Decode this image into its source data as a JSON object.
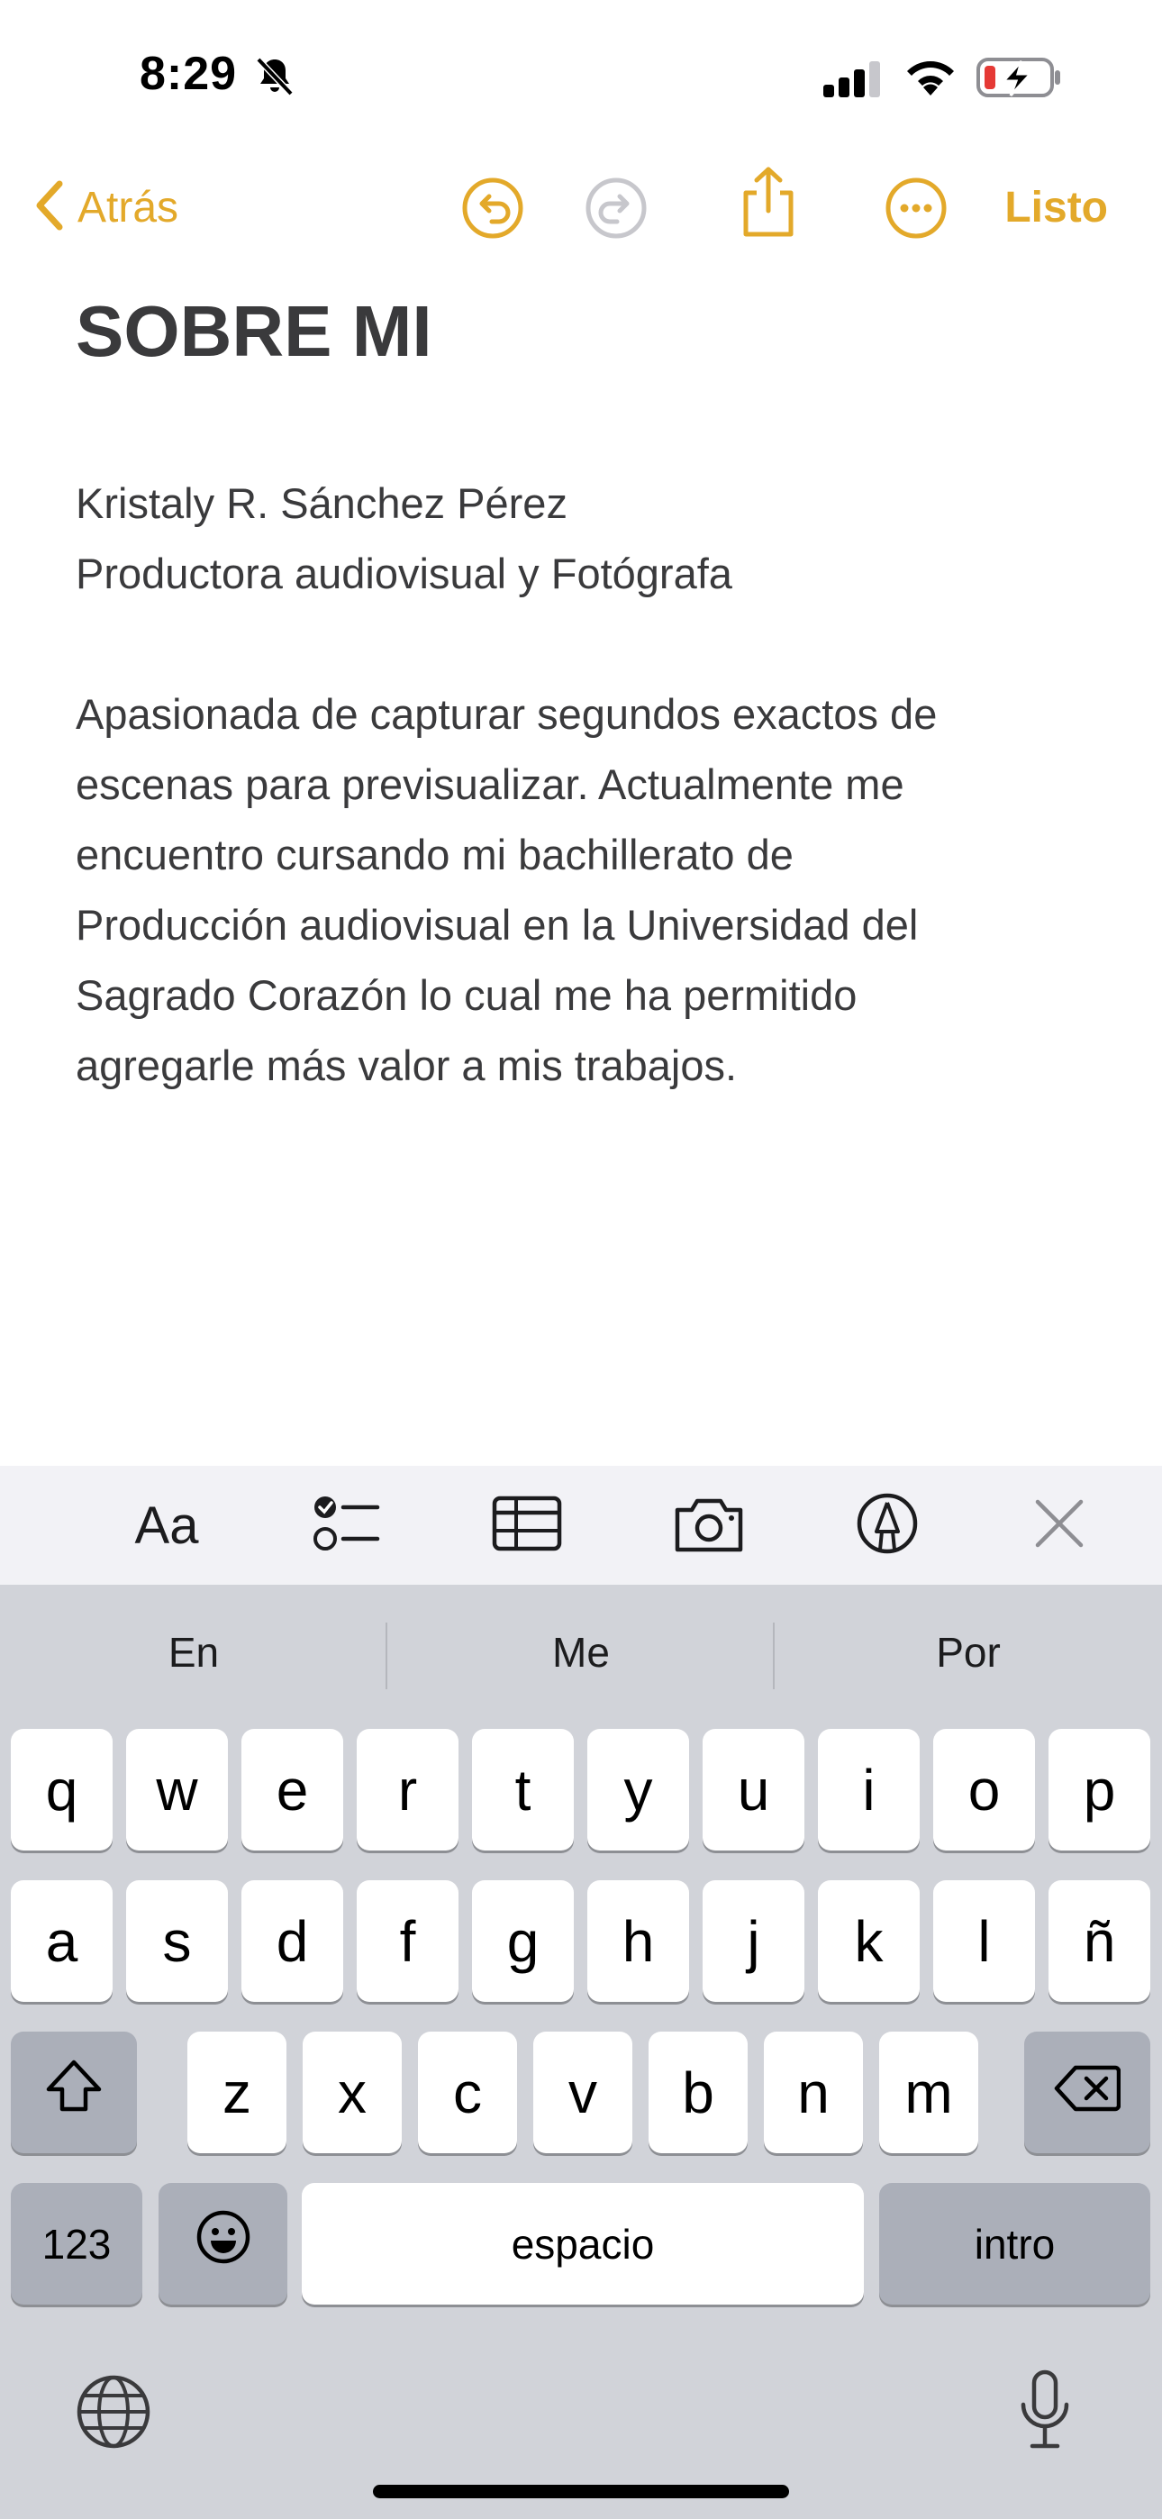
{
  "status_bar": {
    "time": "8:29",
    "battery_color": "#e53935"
  },
  "nav": {
    "back_label": "Atrás",
    "done_label": "Listo",
    "accent_color": "#e3a92a",
    "icons": [
      "chevron-left-icon",
      "undo-icon",
      "redo-icon",
      "share-icon",
      "more-icon"
    ]
  },
  "note": {
    "title": "SOBRE MI",
    "name": "Kristaly R. Sánchez Pérez",
    "role": "Productora audiovisual y Fotógrafa",
    "paragraph_lines": [
      "Apasionada de capturar segundos exactos de",
      "escenas para previsualizar. Actualmente me",
      "encuentro cursando mi bachillerato de",
      "Producción audiovisual en la Universidad del",
      "Sagrado Corazón lo cual me ha permitido",
      "agregarle más valor a mis trabajos."
    ]
  },
  "toolbar": {
    "format_label": "Aa",
    "icons": [
      "checklist-icon",
      "table-icon",
      "camera-icon",
      "markup-icon",
      "close-icon"
    ]
  },
  "keyboard": {
    "suggestions": [
      "En",
      "Me",
      "Por"
    ],
    "row1": [
      "q",
      "w",
      "e",
      "r",
      "t",
      "y",
      "u",
      "i",
      "o",
      "p"
    ],
    "row2": [
      "a",
      "s",
      "d",
      "f",
      "g",
      "h",
      "j",
      "k",
      "l",
      "ñ"
    ],
    "row3": [
      "z",
      "x",
      "c",
      "v",
      "b",
      "n",
      "m"
    ],
    "numbers_label": "123",
    "space_label": "espacio",
    "return_label": "intro"
  }
}
